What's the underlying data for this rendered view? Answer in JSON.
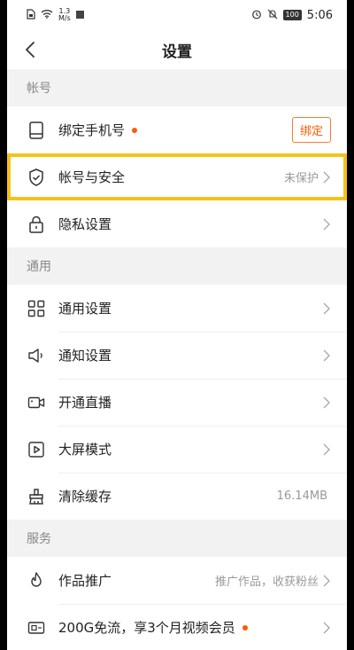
{
  "status_bar": {
    "speed_value": "1.3",
    "speed_unit": "M/s",
    "battery": "100",
    "time": "5:06"
  },
  "header": {
    "title": "设置"
  },
  "sections": {
    "account": {
      "title": "帐号",
      "bind_phone": {
        "label": "绑定手机号",
        "button": "绑定"
      },
      "security": {
        "label": "帐号与安全",
        "value": "未保护"
      },
      "privacy": {
        "label": "隐私设置"
      }
    },
    "general": {
      "title": "通用",
      "general_settings": {
        "label": "通用设置"
      },
      "notification": {
        "label": "通知设置"
      },
      "live": {
        "label": "开通直播"
      },
      "big_screen": {
        "label": "大屏模式"
      },
      "cache": {
        "label": "清除缓存",
        "value": "16.14MB"
      }
    },
    "services": {
      "title": "服务",
      "promotion": {
        "label": "作品推广",
        "value": "推广作品，收获粉丝"
      },
      "free_flow": {
        "label": "200G免流，享3个月视频会员"
      }
    }
  },
  "colors": {
    "accent": "#ff5a00",
    "highlight": "#f5c21a"
  }
}
